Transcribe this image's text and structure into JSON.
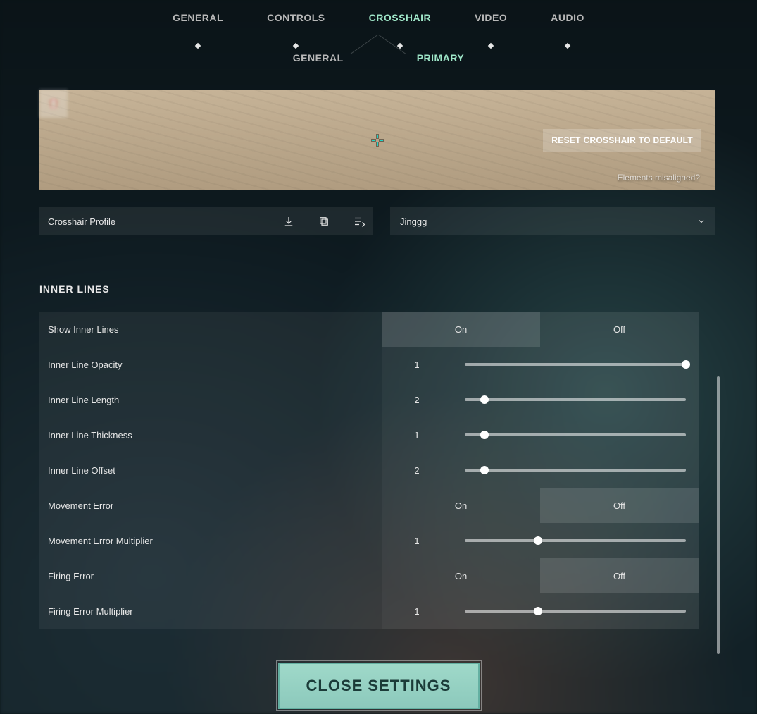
{
  "tabs": {
    "main": [
      "GENERAL",
      "CONTROLS",
      "CROSSHAIR",
      "VIDEO",
      "AUDIO"
    ],
    "main_active": 2,
    "sub": [
      "GENERAL",
      "PRIMARY"
    ],
    "sub_active": 1
  },
  "preview": {
    "reset_label": "RESET CROSSHAIR TO DEFAULT",
    "misaligned_label": "Elements misaligned?"
  },
  "profile": {
    "label": "Crosshair Profile",
    "selected": "Jinggg"
  },
  "section": {
    "title": "INNER LINES"
  },
  "toggle_labels": {
    "on": "On",
    "off": "Off"
  },
  "settings": [
    {
      "key": "show",
      "label": "Show Inner Lines",
      "type": "toggle",
      "value": "On"
    },
    {
      "key": "opacity",
      "label": "Inner Line Opacity",
      "type": "slider",
      "value": "1",
      "pct": 100
    },
    {
      "key": "length",
      "label": "Inner Line Length",
      "type": "slider",
      "value": "2",
      "pct": 9
    },
    {
      "key": "thickness",
      "label": "Inner Line Thickness",
      "type": "slider",
      "value": "1",
      "pct": 9
    },
    {
      "key": "offset",
      "label": "Inner Line Offset",
      "type": "slider",
      "value": "2",
      "pct": 9
    },
    {
      "key": "moverr",
      "label": "Movement Error",
      "type": "toggle",
      "value": "Off"
    },
    {
      "key": "movmult",
      "label": "Movement Error Multiplier",
      "type": "slider",
      "value": "1",
      "pct": 33
    },
    {
      "key": "fireerr",
      "label": "Firing Error",
      "type": "toggle",
      "value": "Off"
    },
    {
      "key": "firemult",
      "label": "Firing Error Multiplier",
      "type": "slider",
      "value": "1",
      "pct": 33
    }
  ],
  "close_label": "CLOSE SETTINGS"
}
